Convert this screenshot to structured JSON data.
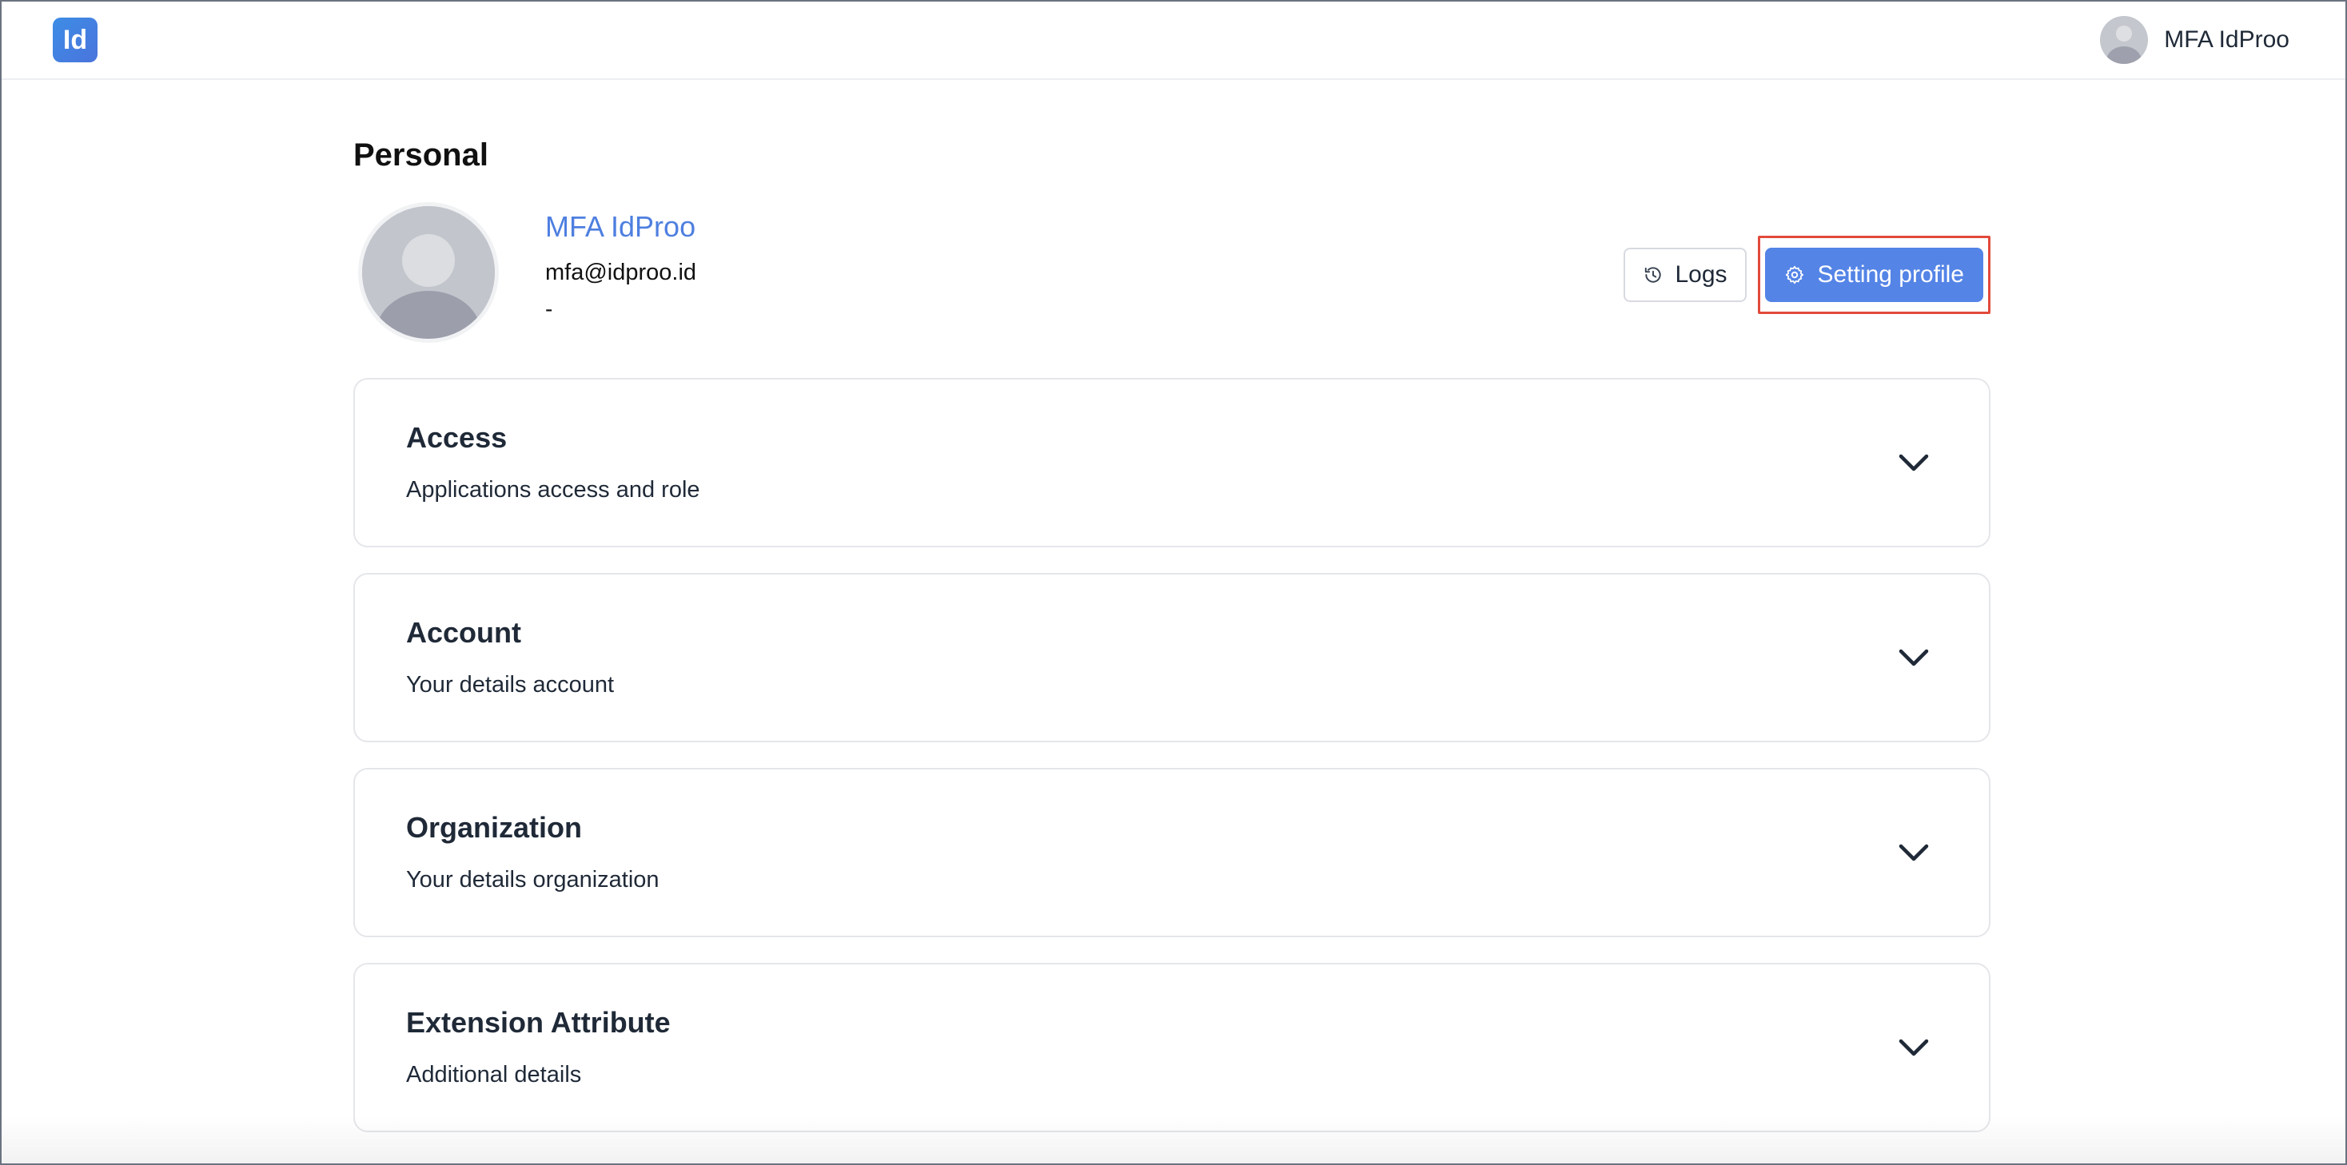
{
  "header": {
    "logo_text": "Id",
    "user_name": "MFA IdProo"
  },
  "page": {
    "title": "Personal"
  },
  "profile": {
    "name": "MFA IdProo",
    "email": "mfa@idproo.id",
    "extra": "-"
  },
  "actions": {
    "logs_label": "Logs",
    "logs_icon": "history-icon",
    "settings_label": "Setting profile",
    "settings_icon": "gear-icon"
  },
  "sections": [
    {
      "title": "Access",
      "subtitle": "Applications access and role"
    },
    {
      "title": "Account",
      "subtitle": "Your details account"
    },
    {
      "title": "Organization",
      "subtitle": "Your details organization"
    },
    {
      "title": "Extension Attribute",
      "subtitle": "Additional details"
    }
  ],
  "colors": {
    "accent": "#5484e6",
    "name_link": "#4e7fe0",
    "highlight_outline": "#e14a3b"
  }
}
